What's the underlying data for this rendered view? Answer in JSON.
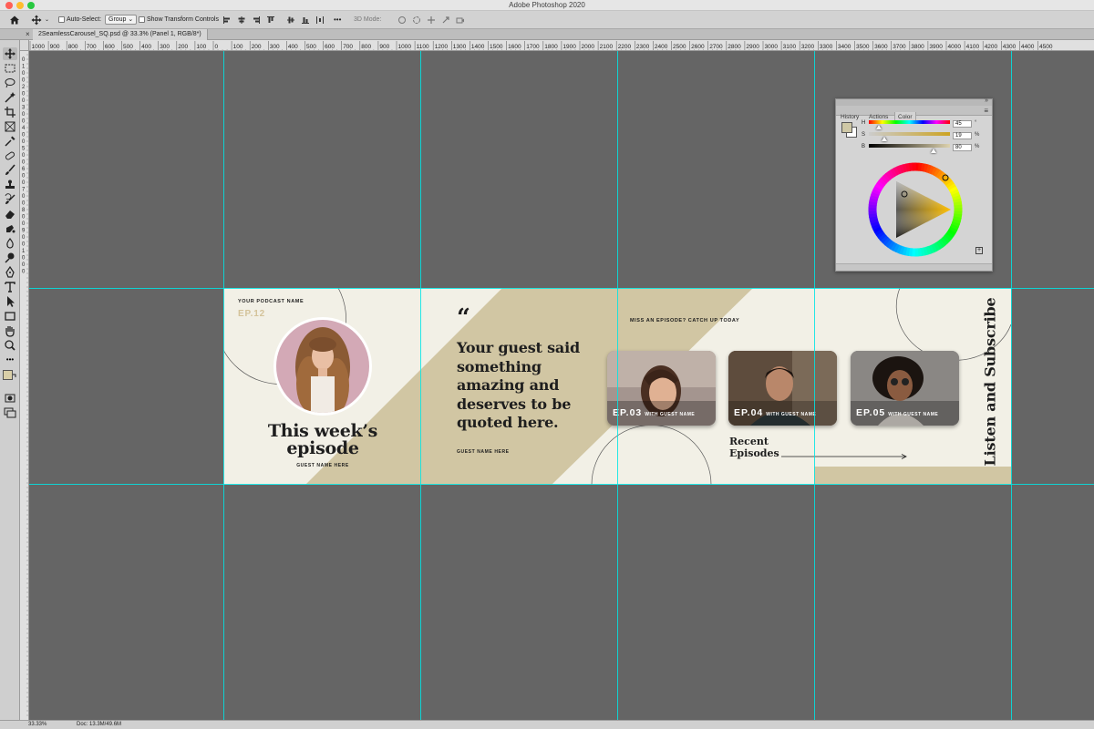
{
  "window": {
    "app_title": "Adobe Photoshop 2020"
  },
  "options_bar": {
    "auto_select_label": "Auto-Select:",
    "auto_select_value": "Group",
    "transform_controls_label": "Show Transform Controls",
    "mode_label": "3D Mode:"
  },
  "document_tab": {
    "title": "2SeamlessCarousel_SQ.psd @ 33.3% (Panel 1, RGB/8*)",
    "close_glyph": "×"
  },
  "ruler": {
    "h_labels": [
      "1000",
      "900",
      "800",
      "700",
      "600",
      "500",
      "400",
      "300",
      "200",
      "100",
      "0",
      "100",
      "200",
      "300",
      "400",
      "500",
      "600",
      "700",
      "800",
      "900",
      "1000",
      "1100",
      "1200",
      "1300",
      "1400",
      "1500",
      "1600",
      "1700",
      "1800",
      "1900",
      "2000",
      "2100",
      "2200",
      "2300",
      "2400",
      "2500",
      "2600",
      "2700",
      "2800",
      "2900",
      "3000",
      "3100",
      "3200",
      "3300",
      "3400",
      "3500",
      "3600",
      "3700",
      "3800",
      "3900",
      "4000",
      "4100",
      "4200",
      "4300",
      "4400",
      "4500"
    ],
    "v_labels": [
      "0",
      "1",
      "0",
      "0",
      "2",
      "0",
      "0",
      "3",
      "0",
      "0",
      "4",
      "0",
      "0",
      "5",
      "0",
      "0",
      "6",
      "0",
      "0",
      "7",
      "0",
      "0",
      "8",
      "0",
      "0",
      "9",
      "0",
      "0",
      "1",
      "0",
      "0",
      "0"
    ]
  },
  "toolbar": {
    "tools": [
      "move-tool",
      "marquee-tool",
      "lasso-tool",
      "magic-wand-tool",
      "crop-tool",
      "frame-tool",
      "eyedropper-tool",
      "healing-tool",
      "brush-tool",
      "stamp-tool",
      "history-brush-tool",
      "eraser-tool",
      "gradient-tool",
      "blur-tool",
      "dodge-tool",
      "pen-tool",
      "type-tool",
      "path-select-tool",
      "shape-tool",
      "hand-tool",
      "zoom-tool",
      "more-tools"
    ],
    "foreground_color": "#d9cfa8",
    "background_color": "#ffffff"
  },
  "canvas": {
    "podcast_name": "YOUR PODCAST NAME",
    "episode_number": "EP.12",
    "headline_line1": "This week’s",
    "headline_line2": "episode",
    "guest_name": "GUEST NAME HERE",
    "quote_mark": "“",
    "quote_lines": [
      "Your guest said",
      "something",
      "amazing and",
      "deserves to be",
      "quoted here."
    ],
    "quote_guest": "GUEST NAME HERE",
    "catch_up": "MISS AN EPISODE? CATCH UP TODAY",
    "episodes": [
      {
        "ep": "EP.03",
        "with": "WITH GUEST NAME"
      },
      {
        "ep": "EP.04",
        "with": "WITH GUEST NAME"
      },
      {
        "ep": "EP.05",
        "with": "WITH GUEST NAME"
      }
    ],
    "recent_line1": "Recent",
    "recent_line2": "Episodes",
    "vertical_text": "Listen and Subscribe",
    "accent_color": "#d1c6a3",
    "bg_color": "#f2f0e6",
    "ep_number_color": "#d4c39a"
  },
  "color_panel": {
    "tabs": [
      "History",
      "Actions",
      "Color"
    ],
    "active_tab": "Color",
    "h_label": "H",
    "h_value": "45",
    "h_unit": "°",
    "s_label": "S",
    "s_value": "19",
    "s_unit": "%",
    "b_label": "B",
    "b_value": "80",
    "b_unit": "%",
    "selected_color": "#cfc8a6"
  },
  "status": {
    "zoom": "33.33%",
    "doc_size": "Doc: 13.3M/49.6M"
  }
}
